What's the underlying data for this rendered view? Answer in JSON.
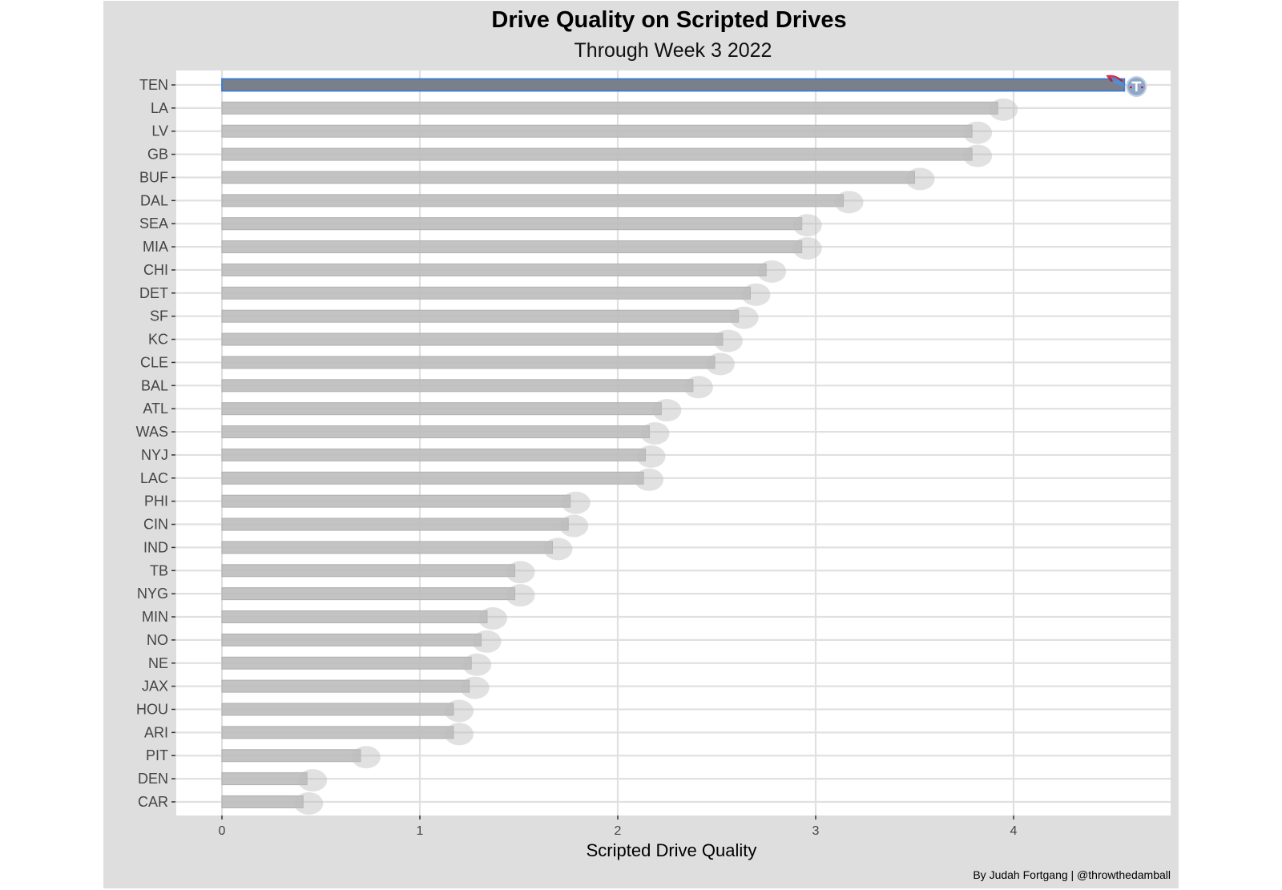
{
  "chart_data": {
    "type": "bar",
    "orientation": "horizontal",
    "title": "Drive Quality on Scripted Drives",
    "subtitle": "Through Week 3 2022",
    "xlabel": "Scripted Drive Quality",
    "ylabel": "",
    "caption": "By Judah Fortgang | @throwthedamball",
    "xlim": [
      -0.23,
      4.9
    ],
    "xticks": [
      "0",
      "1",
      "2",
      "3",
      "4"
    ],
    "grid": true,
    "highlight": "TEN",
    "colors": {
      "background": "#dedede",
      "panel": "#ffffff",
      "grid": "#e0e0e0",
      "bar": "#bdbdbd",
      "highlight_bar": "#7a7f8c",
      "highlight_border": "#3b7bd4"
    },
    "categories": [
      "TEN",
      "LA",
      "LV",
      "GB",
      "BUF",
      "DAL",
      "SEA",
      "MIA",
      "CHI",
      "DET",
      "SF",
      "KC",
      "CLE",
      "BAL",
      "ATL",
      "WAS",
      "NYJ",
      "LAC",
      "PHI",
      "CIN",
      "IND",
      "TB",
      "NYG",
      "MIN",
      "NO",
      "NE",
      "JAX",
      "HOU",
      "ARI",
      "PIT",
      "DEN",
      "CAR"
    ],
    "values": [
      4.56,
      3.92,
      3.79,
      3.79,
      3.5,
      3.14,
      2.93,
      2.93,
      2.75,
      2.67,
      2.61,
      2.53,
      2.49,
      2.38,
      2.22,
      2.16,
      2.14,
      2.13,
      1.76,
      1.75,
      1.67,
      1.48,
      1.48,
      1.34,
      1.31,
      1.26,
      1.25,
      1.17,
      1.17,
      0.7,
      0.43,
      0.41
    ],
    "logo_icons": "team-logo-icon per bar end"
  }
}
